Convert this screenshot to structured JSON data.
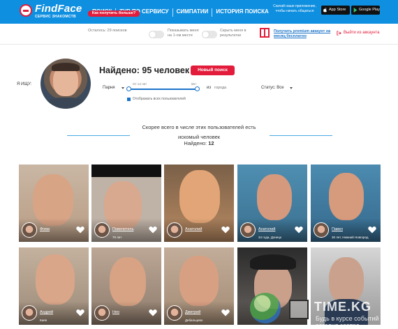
{
  "header": {
    "brand": "FindFace",
    "brand_sub": "СЕРВИС ЗНАКОМСТВ",
    "nav": [
      "ПОИСК",
      "ТУР ПО СЕРВИСУ",
      "СИМПАТИИ",
      "ИСТОРИЯ ПОИСКА"
    ],
    "app_promo": "Скачай наше приложение, чтобы начать общаться",
    "app_store": "App Store",
    "google_play": "Google Play"
  },
  "subbar": {
    "searches_left": "Осталось: 29 поисков",
    "get_more": "Как получить больше?",
    "show_me": "Показывать меня на 1-ом месте",
    "hide_me": "Скрыть меня в результатах",
    "premium": "Получить premium аккаунт на месяц бесплатно",
    "logout": "Выйти из аккаунта"
  },
  "search": {
    "i_seek": "Я ИЩУ:",
    "found_title": "Найдено: 95 человек",
    "new_search": "Новый поиск",
    "gender": "Парня",
    "age_from": "От 14 лет",
    "age_to": "55+",
    "from_label": "из",
    "city_placeholder": "города",
    "status": "Статус: Все",
    "show_all": "Отображать всех пользователей"
  },
  "notice": {
    "text": "Скорее всего в числе этих пользователей есть искомый человек",
    "found_label": "Найдено:",
    "found_value": "12"
  },
  "cards": [
    {
      "name": "Фома",
      "sub": ""
    },
    {
      "name": "Повелитель",
      "sub": "70 лет"
    },
    {
      "name": "Анатолий",
      "sub": ""
    },
    {
      "name": "Анатолий",
      "sub": "34 года, Донецк"
    },
    {
      "name": "Павел",
      "sub": "30 лет, Нижний Новгород"
    },
    {
      "name": "Андрей",
      "sub": "Киев"
    },
    {
      "name": "Нео",
      "sub": ""
    },
    {
      "name": "Дмитрий",
      "sub": "Дебальцево"
    },
    {
      "name": "",
      "sub": ""
    },
    {
      "name": "",
      "sub": ""
    }
  ],
  "watermark": {
    "brand": "TIME.KG",
    "tagline": "Будь в курсе событий сегодня завтра"
  },
  "colors": {
    "header_blue": "#0f8fe0",
    "accent_red": "#e21c3a",
    "link_blue": "#1a73c8"
  }
}
